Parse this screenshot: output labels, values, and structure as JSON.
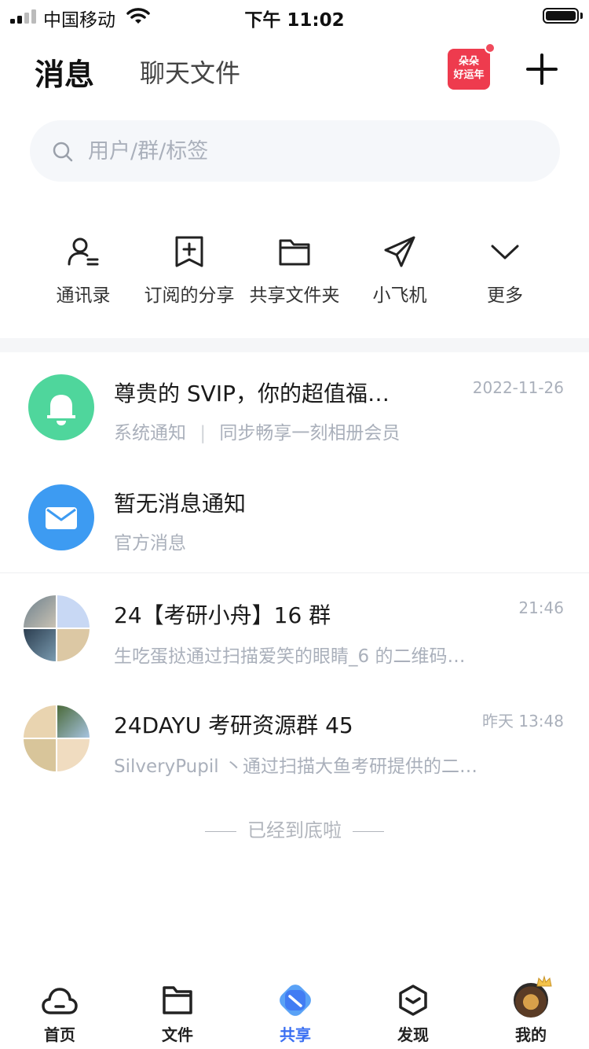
{
  "status_bar": {
    "carrier": "中国移动",
    "time": "下午 11:02"
  },
  "header": {
    "title": "消息",
    "tab_files": "聊天文件",
    "promo_badge": "朵朵好运年"
  },
  "search": {
    "placeholder": "用户/群/标签"
  },
  "shortcuts": [
    {
      "label": "通讯录",
      "icon": "contacts-icon"
    },
    {
      "label": "订阅的分享",
      "icon": "bookmark-add-icon"
    },
    {
      "label": "共享文件夹",
      "icon": "folder-icon"
    },
    {
      "label": "小飞机",
      "icon": "paper-plane-icon"
    },
    {
      "label": "更多",
      "icon": "chevron-down-icon"
    }
  ],
  "messages": [
    {
      "title": "尊贵的 SVIP，你的超值福…",
      "subtitle_source": "系统通知",
      "subtitle": "同步畅享一刻相册会员",
      "time": "2022-11-26",
      "icon": "bell-icon",
      "color": "#4fd69c"
    },
    {
      "title": "暂无消息通知",
      "subtitle": "官方消息",
      "icon": "mail-icon",
      "color": "#3d9bf2"
    },
    {
      "title": "24【考研小舟】16 群",
      "subtitle": "生吃蛋挞通过扫描爱笑的眼睛_6 的二维码…",
      "time": "21:46"
    },
    {
      "title": "24DAYU 考研资源群 45",
      "subtitle": "SilveryPupil 丶通过扫描大鱼考研提供的二…",
      "time": "昨天 13:48"
    }
  ],
  "end_tip": "已经到底啦",
  "tabs": [
    {
      "label": "首页",
      "icon": "cloud-icon"
    },
    {
      "label": "文件",
      "icon": "file-folder-icon"
    },
    {
      "label": "共享",
      "icon": "share-icon",
      "active": true
    },
    {
      "label": "发现",
      "icon": "discover-box-icon"
    },
    {
      "label": "我的",
      "icon": "profile-avatar"
    }
  ],
  "colors": {
    "accent": "#3a6ff2",
    "promo": "#ee3b4e"
  }
}
